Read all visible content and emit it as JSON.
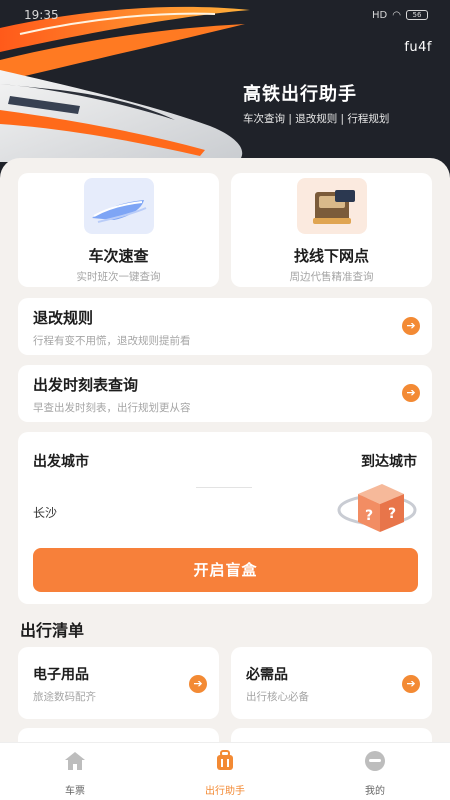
{
  "status_bar": {
    "time": "19:35",
    "signal": "HD",
    "battery": "56"
  },
  "header": {
    "app_tag": "fu4f",
    "title": "高铁出行助手",
    "subtitle": "车次查询 | 退改规则 | 行程规划"
  },
  "quick_cards": [
    {
      "title": "车次速查",
      "subtitle": "实时班次一键查询",
      "icon": "train-icon"
    },
    {
      "title": "找线下网点",
      "subtitle": "周边代售精准查询",
      "icon": "ticket-machine-icon"
    }
  ],
  "rows": [
    {
      "title": "退改规则",
      "subtitle": "行程有变不用慌，退改规则提前看"
    },
    {
      "title": "出发时刻表查询",
      "subtitle": "早查出发时刻表，出行规划更从容"
    }
  ],
  "city_search": {
    "from_label": "出发城市",
    "to_label": "到达城市",
    "from_value": "长沙",
    "button": "开启盲盒"
  },
  "checklist": {
    "title": "出行清单",
    "items": [
      {
        "title": "电子用品",
        "subtitle": "旅途数码配齐"
      },
      {
        "title": "必需品",
        "subtitle": "出行核心必备"
      }
    ]
  },
  "tabs": [
    {
      "label": "车票",
      "icon": "home-icon",
      "active": false
    },
    {
      "label": "出行助手",
      "icon": "luggage-icon",
      "active": true
    },
    {
      "label": "我的",
      "icon": "profile-icon",
      "active": false
    }
  ],
  "colors": {
    "accent": "#f38a34",
    "header_bg": "#1f2229",
    "page_bg": "#f4f1ee"
  }
}
